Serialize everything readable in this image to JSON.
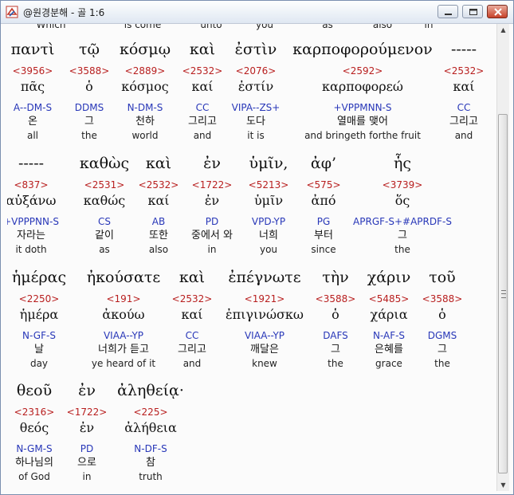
{
  "window": {
    "title": "@원경분해 - 골 1:6",
    "colors": {
      "red": "#b81f1f",
      "blue": "#2837b8"
    }
  },
  "prev_row": [
    "Which",
    "is come",
    "unto",
    "you",
    "as",
    "also",
    "in"
  ],
  "rows": [
    {
      "words": [
        {
          "greek": "παντὶ",
          "strong": "<3956>",
          "lemma": "πᾶς",
          "parse": "A--DM-S",
          "korean": "온",
          "english": "all"
        },
        {
          "greek": "τῷ",
          "strong": "<3588>",
          "lemma": "ὁ",
          "parse": "DDMS",
          "korean": "그",
          "english": "the"
        },
        {
          "greek": "κόσμῳ",
          "strong": "<2889>",
          "lemma": "κόσμος",
          "parse": "N-DM-S",
          "korean": "천하",
          "english": "world"
        },
        {
          "greek": "καὶ",
          "strong": "<2532>",
          "lemma": "καί",
          "parse": "CC",
          "korean": "그리고",
          "english": "and"
        },
        {
          "greek": "ἐστὶν",
          "strong": "<2076>",
          "lemma": "ἐστίν",
          "parse": "VIPA--ZS+",
          "korean": "도다",
          "english": "it is"
        },
        {
          "greek": "καρποφορούμενον",
          "strong": "<2592>",
          "lemma": "καρποφορεώ",
          "parse": "+VPPMNN-S",
          "korean": "열매를 맺어",
          "english": "and bringeth forthe fruit"
        },
        {
          "greek": "-----",
          "strong": "<2532>",
          "lemma": "καί",
          "parse": "CC",
          "korean": "그리고",
          "english": "and"
        }
      ]
    },
    {
      "words": [
        {
          "greek": "-----",
          "strong": "<837>",
          "lemma": "αὐξάνω",
          "parse": "+VPPPNN-S",
          "korean": "자라는",
          "english": "it doth"
        },
        {
          "greek": "καθὼς",
          "strong": "<2531>",
          "lemma": "καθώς",
          "parse": "CS",
          "korean": "같이",
          "english": "as"
        },
        {
          "greek": "καὶ",
          "strong": "<2532>",
          "lemma": "καί",
          "parse": "AB",
          "korean": "또한",
          "english": "also"
        },
        {
          "greek": "ἐν",
          "strong": "<1722>",
          "lemma": "ἐν",
          "parse": "PD",
          "korean": "중에서 와",
          "english": "in"
        },
        {
          "greek": "ὑμῖν,",
          "strong": "<5213>",
          "lemma": "ὑμῖν",
          "parse": "VPD-YP",
          "korean": "너희",
          "english": "you"
        },
        {
          "greek": "ἀφ’",
          "strong": "<575>",
          "lemma": "ἀπό",
          "parse": "PG",
          "korean": "부터",
          "english": "since"
        },
        {
          "greek": "ἧς",
          "strong": "<3739>",
          "lemma": "ὅς",
          "parse": "APRGF-S+#APRDF-S",
          "korean": "그",
          "english": "the"
        }
      ]
    },
    {
      "words": [
        {
          "greek": "ἡμέρας",
          "strong": "<2250>",
          "lemma": "ἡμέρα",
          "parse": "N-GF-S",
          "korean": "날",
          "english": "day"
        },
        {
          "greek": "ἠκούσατε",
          "strong": "<191>",
          "lemma": "ἀκούω",
          "parse": "VIAA--YP",
          "korean": "너희가 듣고",
          "english": "ye heard of it"
        },
        {
          "greek": "καὶ",
          "strong": "<2532>",
          "lemma": "καί",
          "parse": "CC",
          "korean": "그리고",
          "english": "and"
        },
        {
          "greek": "ἐπέγνωτε",
          "strong": "<1921>",
          "lemma": "ἐπιγινώσκω",
          "parse": "VIAA--YP",
          "korean": "깨달은",
          "english": "knew"
        },
        {
          "greek": "τὴν",
          "strong": "<3588>",
          "lemma": "ὁ",
          "parse": "DAFS",
          "korean": "그",
          "english": "the"
        },
        {
          "greek": "χάριν",
          "strong": "<5485>",
          "lemma": "χάρια",
          "parse": "N-AF-S",
          "korean": "은혜를",
          "english": "grace"
        },
        {
          "greek": "τοῦ",
          "strong": "<3588>",
          "lemma": "ὁ",
          "parse": "DGMS",
          "korean": "그",
          "english": "the"
        }
      ]
    },
    {
      "words": [
        {
          "greek": "θεοῦ",
          "strong": "<2316>",
          "lemma": "θεός",
          "parse": "N-GM-S",
          "korean": "하나님의",
          "english": "of God"
        },
        {
          "greek": "ἐν",
          "strong": "<1722>",
          "lemma": "ἐν",
          "parse": "PD",
          "korean": "으로",
          "english": "in"
        },
        {
          "greek": "ἀληθείᾳ·",
          "strong": "<225>",
          "lemma": "ἀλήθεια",
          "parse": "N-DF-S",
          "korean": "참",
          "english": "truth"
        }
      ]
    }
  ]
}
